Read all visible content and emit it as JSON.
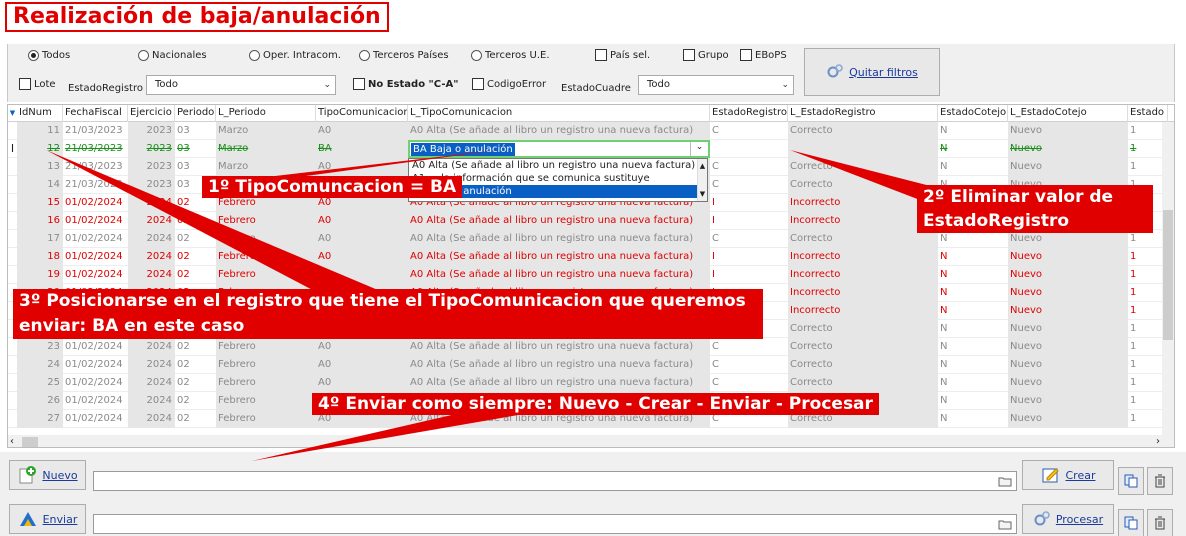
{
  "title": "Realización de baja/anulación",
  "filters": {
    "radios": [
      {
        "label": "Todos",
        "selected": true
      },
      {
        "label": "Nacionales",
        "selected": false
      },
      {
        "label": "Oper. Intracom.",
        "selected": false
      },
      {
        "label": "Terceros Países",
        "selected": false
      },
      {
        "label": "Terceros U.E.",
        "selected": false
      }
    ],
    "checks_top": [
      "País sel.",
      "Grupo",
      "EBoPS"
    ],
    "lote_label": "Lote",
    "estado_registro_label": "EstadoRegistro",
    "estado_registro_value": "Todo",
    "no_estado_label": "No Estado \"C-A\"",
    "codigo_error_label": "CodigoError",
    "estado_cuadre_label": "EstadoCuadre",
    "estado_cuadre_value": "Todo",
    "quitar_filtros": "Quitar filtros"
  },
  "grid": {
    "columns": [
      "IdNum",
      "FechaFiscal",
      "Ejercicio",
      "Periodo",
      "L_Periodo",
      "TipoComunicacion",
      "L_TipoComunicacion",
      "EstadoRegistro",
      "L_EstadoRegistro",
      "EstadoCotejo",
      "L_EstadoCotejo",
      "Estado"
    ],
    "rows": [
      {
        "id": "11",
        "fecha": "21/03/2023",
        "ejercicio": "2023",
        "periodo": "03",
        "lperiodo": "Marzo",
        "tipo": "A0",
        "ltipo": "A0 Alta (Se añade al libro un registro una nueva factura)",
        "estreg": "C",
        "lestreg": "Correcto",
        "estcot": "N",
        "lestcot": "Nuevo",
        "estado": "1",
        "style": "gray"
      },
      {
        "id": "12",
        "fecha": "21/03/2023",
        "ejercicio": "2023",
        "periodo": "03",
        "lperiodo": "Marzo",
        "tipo": "BA",
        "ltipo": "BA Baja o anulación",
        "estreg": "",
        "lestreg": "",
        "estcot": "N",
        "lestcot": "Nuevo",
        "estado": "1",
        "style": "green",
        "indicator": "I"
      },
      {
        "id": "13",
        "fecha": "21/03/2023",
        "ejercicio": "2023",
        "periodo": "03",
        "lperiodo": "Marzo",
        "tipo": "A0",
        "ltipo": "A0 Alta (Se añade al libro un registro una nueva factura)",
        "estreg": "C",
        "lestreg": "Correcto",
        "estcot": "N",
        "lestcot": "Nuevo",
        "estado": "1",
        "style": "gray"
      },
      {
        "id": "14",
        "fecha": "21/03/2023",
        "ejercicio": "2023",
        "periodo": "03",
        "lperiodo": "Marzo",
        "tipo": "A0",
        "ltipo": "A0 Alta (Se añade al libro un registro una nueva factura)",
        "estreg": "C",
        "lestreg": "Correcto",
        "estcot": "N",
        "lestcot": "Nuevo",
        "estado": "1",
        "style": "gray"
      },
      {
        "id": "15",
        "fecha": "01/02/2024",
        "ejercicio": "2024",
        "periodo": "02",
        "lperiodo": "Febrero",
        "tipo": "A0",
        "ltipo": "A0 Alta (Se añade al libro un registro una nueva factura)",
        "estreg": "I",
        "lestreg": "Incorrecto",
        "estcot": "N",
        "lestcot": "Nuevo",
        "estado": "1",
        "style": "red"
      },
      {
        "id": "16",
        "fecha": "01/02/2024",
        "ejercicio": "2024",
        "periodo": "02",
        "lperiodo": "Febrero",
        "tipo": "A0",
        "ltipo": "A0 Alta (Se añade al libro un registro una nueva factura)",
        "estreg": "I",
        "lestreg": "Incorrecto",
        "estcot": "N",
        "lestcot": "Nuevo",
        "estado": "1",
        "style": "red"
      },
      {
        "id": "17",
        "fecha": "01/02/2024",
        "ejercicio": "2024",
        "periodo": "02",
        "lperiodo": "Febrero",
        "tipo": "A0",
        "ltipo": "A0 Alta (Se añade al libro un registro una nueva factura)",
        "estreg": "C",
        "lestreg": "Correcto",
        "estcot": "N",
        "lestcot": "Nuevo",
        "estado": "1",
        "style": "gray"
      },
      {
        "id": "18",
        "fecha": "01/02/2024",
        "ejercicio": "2024",
        "periodo": "02",
        "lperiodo": "Febrero",
        "tipo": "A0",
        "ltipo": "A0 Alta (Se añade al libro un registro una nueva factura)",
        "estreg": "I",
        "lestreg": "Incorrecto",
        "estcot": "N",
        "lestcot": "Nuevo",
        "estado": "1",
        "style": "red"
      },
      {
        "id": "19",
        "fecha": "01/02/2024",
        "ejercicio": "2024",
        "periodo": "02",
        "lperiodo": "Febrero",
        "tipo": "A0",
        "ltipo": "A0 Alta (Se añade al libro un registro una nueva factura)",
        "estreg": "I",
        "lestreg": "Incorrecto",
        "estcot": "N",
        "lestcot": "Nuevo",
        "estado": "1",
        "style": "red"
      },
      {
        "id": "20",
        "fecha": "01/02/2024",
        "ejercicio": "2024",
        "periodo": "02",
        "lperiodo": "Febrero",
        "tipo": "A0",
        "ltipo": "A0 Alta (Se añade al libro un registro una nueva factura)",
        "estreg": "I",
        "lestreg": "Incorrecto",
        "estcot": "N",
        "lestcot": "Nuevo",
        "estado": "1",
        "style": "red"
      },
      {
        "id": "21",
        "fecha": "01/02/2024",
        "ejercicio": "2024",
        "periodo": "02",
        "lperiodo": "Febrero",
        "tipo": "A0",
        "ltipo": "A0 Alta (Se añade al libro un registro una nueva factura)",
        "estreg": "I",
        "lestreg": "Incorrecto",
        "estcot": "N",
        "lestcot": "Nuevo",
        "estado": "1",
        "style": "red"
      },
      {
        "id": "22",
        "fecha": "01/02/2024",
        "ejercicio": "2024",
        "periodo": "02",
        "lperiodo": "Febrero",
        "tipo": "A0",
        "ltipo": "A0 Alta (Se añade al libro un registro una nueva factura)",
        "estreg": "C",
        "lestreg": "Correcto",
        "estcot": "N",
        "lestcot": "Nuevo",
        "estado": "1",
        "style": "gray"
      },
      {
        "id": "23",
        "fecha": "01/02/2024",
        "ejercicio": "2024",
        "periodo": "02",
        "lperiodo": "Febrero",
        "tipo": "A0",
        "ltipo": "A0 Alta (Se añade al libro un registro una nueva factura)",
        "estreg": "C",
        "lestreg": "Correcto",
        "estcot": "N",
        "lestcot": "Nuevo",
        "estado": "1",
        "style": "gray"
      },
      {
        "id": "24",
        "fecha": "01/02/2024",
        "ejercicio": "2024",
        "periodo": "02",
        "lperiodo": "Febrero",
        "tipo": "A0",
        "ltipo": "A0 Alta (Se añade al libro un registro una nueva factura)",
        "estreg": "C",
        "lestreg": "Correcto",
        "estcot": "N",
        "lestcot": "Nuevo",
        "estado": "1",
        "style": "gray"
      },
      {
        "id": "25",
        "fecha": "01/02/2024",
        "ejercicio": "2024",
        "periodo": "02",
        "lperiodo": "Febrero",
        "tipo": "A0",
        "ltipo": "A0 Alta (Se añade al libro un registro una nueva factura)",
        "estreg": "C",
        "lestreg": "Correcto",
        "estcot": "N",
        "lestcot": "Nuevo",
        "estado": "1",
        "style": "gray"
      },
      {
        "id": "26",
        "fecha": "01/02/2024",
        "ejercicio": "2024",
        "periodo": "02",
        "lperiodo": "Febrero",
        "tipo": "A0",
        "ltipo": "A0 Alta (Se añade al libro un registro una nueva factura)",
        "estreg": "C",
        "lestreg": "Correcto",
        "estcot": "N",
        "lestcot": "Nuevo",
        "estado": "1",
        "style": "gray"
      },
      {
        "id": "27",
        "fecha": "01/02/2024",
        "ejercicio": "2024",
        "periodo": "02",
        "lperiodo": "Febrero",
        "tipo": "A0",
        "ltipo": "A0 Alta (Se añade al libro un registro una nueva factura)",
        "estreg": "C",
        "lestreg": "Correcto",
        "estcot": "N",
        "lestcot": "Nuevo",
        "estado": "1",
        "style": "gray"
      }
    ],
    "editor_value": "BA Baja o anulación",
    "dropdown_items": [
      "A0 Alta (Se añade al libro un registro una nueva factura)",
      "A1 ... la información que se comunica sustituye",
      "BA Baja o anulación"
    ]
  },
  "annotations": {
    "step1": "1º TipoComuncacion = BA",
    "step2": "2º Eliminar valor de EstadoRegistro",
    "step3": "3º Posicionarse en el registro que tiene el TipoComunicacion que queremos enviar: BA en este caso",
    "step4": "4º Enviar como siempre: Nuevo - Crear - Enviar - Procesar"
  },
  "bottom": {
    "nuevo": "Nuevo",
    "enviar": "Enviar",
    "crear": "Crear",
    "procesar": "Procesar",
    "path1": "",
    "path2": ""
  },
  "colors": {
    "accent": "#e00000",
    "link": "#1a3b9a",
    "selection": "#0a5fc4",
    "edit_border": "#6fd16f"
  }
}
